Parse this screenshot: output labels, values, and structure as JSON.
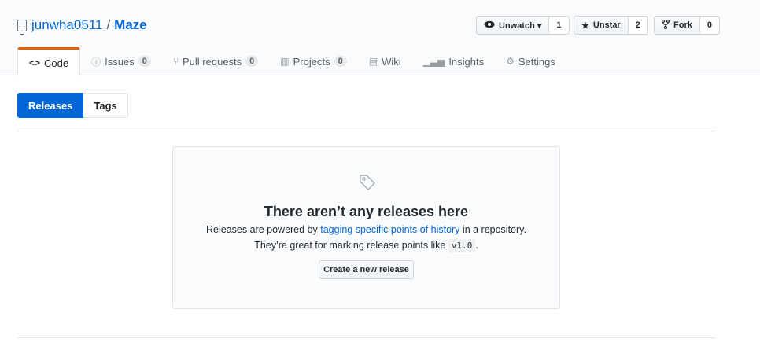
{
  "repo": {
    "owner": "junwha0511",
    "separator": "/",
    "name": "Maze"
  },
  "actions": [
    {
      "icon": "eye-icon",
      "label": "Unwatch ▾",
      "count": "1"
    },
    {
      "icon": "star-icon",
      "label": "Unstar",
      "count": "2"
    },
    {
      "icon": "fork-icon",
      "label": "Fork",
      "count": "0"
    }
  ],
  "tabs": [
    {
      "icon": "code-icon",
      "label": "Code",
      "counter": ""
    },
    {
      "icon": "issue-icon",
      "label": "Issues",
      "counter": "0"
    },
    {
      "icon": "pull-request-icon",
      "label": "Pull requests",
      "counter": "0"
    },
    {
      "icon": "project-icon",
      "label": "Projects",
      "counter": "0"
    },
    {
      "icon": "wiki-icon",
      "label": "Wiki",
      "counter": ""
    },
    {
      "icon": "insights-icon",
      "label": "Insights",
      "counter": ""
    },
    {
      "icon": "gear-icon",
      "label": "Settings",
      "counter": ""
    }
  ],
  "subnav": {
    "releases": "Releases",
    "tags": "Tags"
  },
  "blankslate": {
    "heading": "There aren’t any releases here",
    "line1_pre": "Releases are powered by ",
    "line1_link": "tagging specific points of history",
    "line1_post": " in a repository.",
    "line2_pre": "They’re great for marking release points like ",
    "line2_code": "v1.0",
    "line2_post": ".",
    "button": "Create a new release"
  },
  "colors": {
    "link": "#0366d6",
    "selected_tab_border": "#e36209"
  }
}
